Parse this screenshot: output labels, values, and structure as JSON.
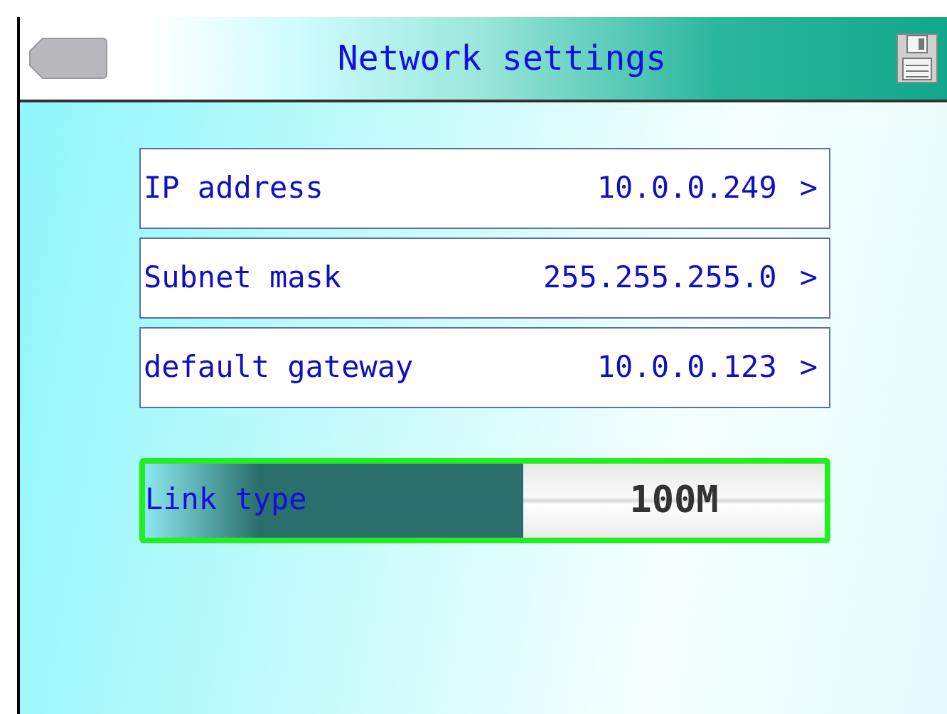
{
  "header": {
    "title": "Network settings"
  },
  "settings": [
    {
      "label": "IP address",
      "value": "10.0.0.249",
      "chevron": ">"
    },
    {
      "label": "Subnet mask",
      "value": "255.255.255.0",
      "chevron": ">"
    },
    {
      "label": "default gateway",
      "value": "10.0.0.123",
      "chevron": ">"
    }
  ],
  "link_type": {
    "label": "Link type",
    "value": "100M",
    "selected": true
  }
}
